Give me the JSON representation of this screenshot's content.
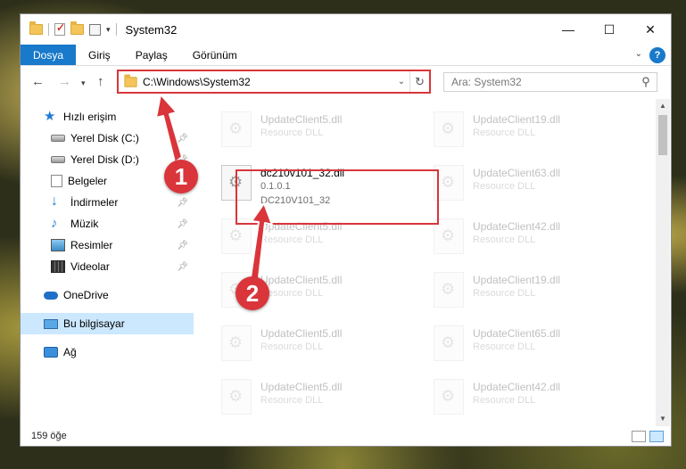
{
  "window": {
    "title": "System32",
    "controls": {
      "minimize": "—",
      "maximize": "☐",
      "close": "✕"
    }
  },
  "ribbon": {
    "tabs": [
      "Dosya",
      "Giriş",
      "Paylaş",
      "Görünüm"
    ],
    "help": "?"
  },
  "address": {
    "path": "C:\\Windows\\System32",
    "search_placeholder": "Ara: System32"
  },
  "nav": {
    "items": [
      {
        "label": "Hızlı erişim",
        "icon": "star-icon"
      },
      {
        "label": "Yerel Disk (C:)",
        "icon": "disk-icon",
        "pinned": true
      },
      {
        "label": "Yerel Disk (D:)",
        "icon": "disk-icon",
        "pinned": true
      },
      {
        "label": "Belgeler",
        "icon": "document-icon",
        "pinned": true
      },
      {
        "label": "İndirmeler",
        "icon": "download-icon",
        "pinned": true
      },
      {
        "label": "Müzik",
        "icon": "music-icon",
        "pinned": true
      },
      {
        "label": "Resimler",
        "icon": "pictures-icon",
        "pinned": true
      },
      {
        "label": "Videolar",
        "icon": "video-icon",
        "pinned": true
      },
      {
        "label": "OneDrive",
        "icon": "cloud-icon"
      },
      {
        "label": "Bu bilgisayar",
        "icon": "computer-icon",
        "selected": true
      },
      {
        "label": "Ağ",
        "icon": "network-icon"
      }
    ]
  },
  "files": {
    "left": [
      {
        "name": "UpdateClient5.dll",
        "type": "Resource DLL"
      },
      {
        "name": "dc210v101_32.dll",
        "version": "0.1.0.1",
        "desc": "DC210V101_32"
      },
      {
        "name": "UpdateClient5.dll",
        "type": "Resource DLL"
      },
      {
        "name": "UpdateClient5.dll",
        "type": "Resource DLL"
      },
      {
        "name": "UpdateClient5.dll",
        "type": "Resource DLL"
      },
      {
        "name": "UpdateClient5.dll",
        "type": "Resource DLL"
      }
    ],
    "right": [
      {
        "name": "UpdateClient19.dll",
        "type": "Resource DLL"
      },
      {
        "name": "UpdateClient63.dll",
        "type": "Resource DLL"
      },
      {
        "name": "UpdateClient42.dll",
        "type": "Resource DLL"
      },
      {
        "name": "UpdateClient19.dll",
        "type": "Resource DLL"
      },
      {
        "name": "UpdateClient65.dll",
        "type": "Resource DLL"
      },
      {
        "name": "UpdateClient42.dll",
        "type": "Resource DLL"
      }
    ]
  },
  "status": {
    "count": "159 öğe"
  },
  "annotations": {
    "step1": "1",
    "step2": "2",
    "color": "#d9353b"
  }
}
